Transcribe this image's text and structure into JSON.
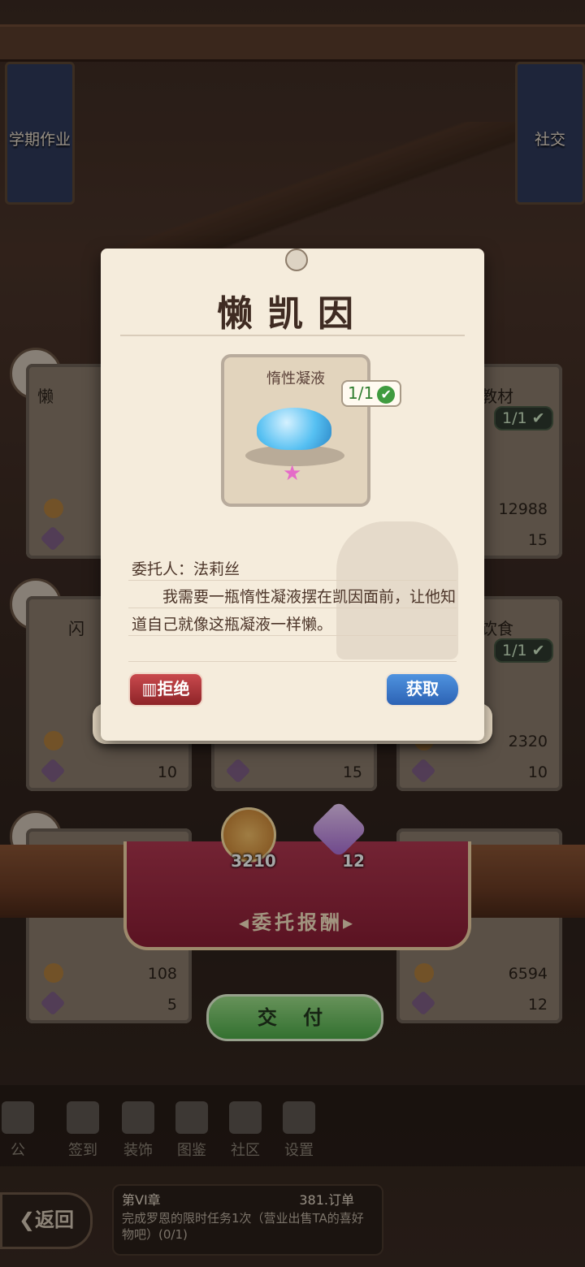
{
  "top_left_tab": {
    "label": "学期作业"
  },
  "top_right_tab": {
    "label": "社交"
  },
  "background_board": {
    "cards": [
      {
        "title": "懒",
        "coins": "",
        "gems": ""
      },
      {
        "title": "教材",
        "check": "1/1",
        "coins": "12988",
        "gems": "15"
      },
      {
        "title": "闪",
        "coins": "",
        "gems": "10"
      },
      {
        "title": "",
        "coins": "",
        "gems": "15"
      },
      {
        "title": "饮食",
        "check": "1/1",
        "coins": "2320",
        "gems": "10"
      },
      {
        "title": "",
        "coins": "108",
        "gems": "5"
      },
      {
        "title": "",
        "coins": "6594",
        "gems": "12"
      }
    ]
  },
  "reward": {
    "coins": "3210",
    "gems": "12",
    "banner_label": "委托报酬"
  },
  "deliver_button": {
    "label": "交 付"
  },
  "nav": {
    "items": [
      {
        "label": "公"
      },
      {
        "label": "签到"
      },
      {
        "label": "装饰"
      },
      {
        "label": "图鉴"
      },
      {
        "label": "社区"
      },
      {
        "label": "设置"
      }
    ]
  },
  "back_button": {
    "label": "返回"
  },
  "quest": {
    "chapter": "第VI章",
    "orders": "381.订单",
    "task": "完成罗恩的限时任务1次（营业出售TA的喜好物吧）(0/1)"
  },
  "modal": {
    "title": "懒凯因",
    "item_name": "惰性凝液",
    "item_count": "1/1",
    "client_label": "委托人：法莉丝",
    "description": "我需要一瓶惰性凝液摆在凯因面前，让他知道自己就像这瓶凝液一样懒。",
    "refuse_label": "拒绝",
    "accept_label": "获取"
  },
  "colors": {
    "modal_bg": "#f5ecdc",
    "refuse": "#b8373b",
    "accept": "#3a78c9",
    "deliver": "#6fca5f",
    "banner": "#a02a44"
  }
}
